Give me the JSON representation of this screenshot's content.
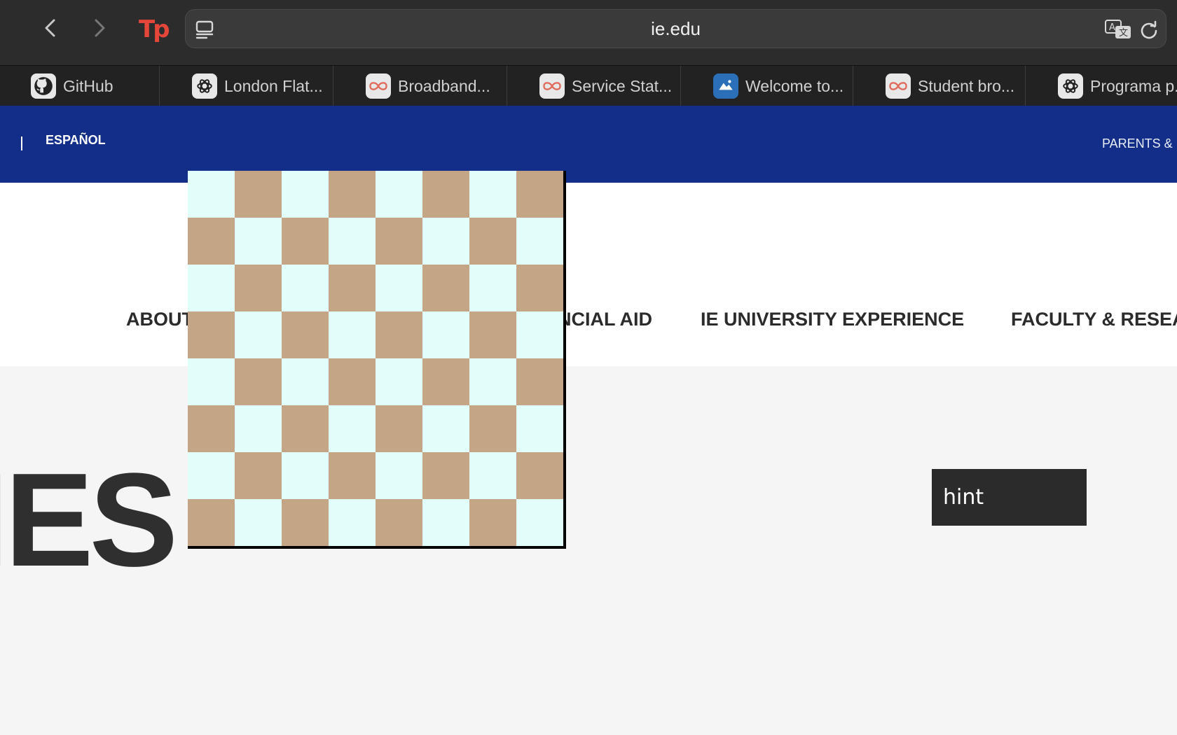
{
  "browser": {
    "url": "ie.edu",
    "extension_logo_text": "Tp",
    "icons": {
      "back": "chevron-left-icon",
      "forward": "chevron-right-icon",
      "sidebar": "sidebar-icon",
      "translate": "translate-icon",
      "reload": "reload-icon"
    }
  },
  "favorites": [
    {
      "label": "GitHub",
      "icon": "github-icon"
    },
    {
      "label": "London Flat...",
      "icon": "openai-icon"
    },
    {
      "label": "Broadband...",
      "icon": "infinity-icon"
    },
    {
      "label": "Service Stat...",
      "icon": "infinity-icon"
    },
    {
      "label": "Welcome to...",
      "icon": "map-icon"
    },
    {
      "label": "Student bro...",
      "icon": "infinity-icon"
    },
    {
      "label": "Programa p...",
      "icon": "openai-icon"
    }
  ],
  "site": {
    "language_link": "ESPAÑOL",
    "parents_link": "PARENTS &",
    "nav": [
      "ABOUT",
      "NCIAL AID",
      "IE UNIVERSITY EXPERIENCE",
      "FACULTY & RESEA"
    ],
    "hero_text": "IES"
  },
  "overlay": {
    "board": {
      "rows": 8,
      "cols": 8,
      "light_color": "#e1fefa",
      "dark_color": "#c4a686",
      "top_left": "light"
    },
    "hint_label": "hint"
  },
  "colors": {
    "site_blue": "#122e88",
    "toolbar": "#2c2c2c"
  }
}
